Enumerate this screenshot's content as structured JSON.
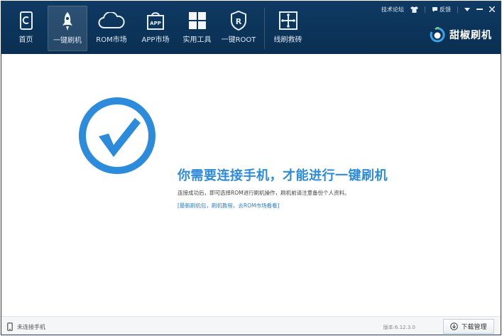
{
  "nav": {
    "items": [
      {
        "label": "首页",
        "icon": "phone-icon"
      },
      {
        "label": "一键刷机",
        "icon": "rocket-icon",
        "active": true
      },
      {
        "label": "ROM市场",
        "icon": "cloud-icon"
      },
      {
        "label": "APP市场",
        "icon": "app-bag-icon"
      },
      {
        "label": "实用工具",
        "icon": "grid-tools-icon"
      },
      {
        "label": "一键ROOT",
        "icon": "root-shield-icon"
      },
      {
        "label": "线刷救砖",
        "icon": "usb-rescue-icon"
      }
    ]
  },
  "system": {
    "forum": "技术论坛",
    "feedback": "反馈"
  },
  "brand": {
    "name": "甜椒刷机"
  },
  "main": {
    "headline": "你需要连接手机，才能进行一键刷机",
    "description": "连接成功后，即可选择ROM进行刷机操作，刷机前请注意备份个人资料。",
    "link": "[最新刷机包，刷机教程，去ROM市场看看]"
  },
  "status": {
    "connection": "未连接手机",
    "version": "版本:6.12.3.0",
    "download_button": "下载管理"
  },
  "colors": {
    "topbar": "#0f3a63",
    "accent": "#2c8bdb"
  }
}
